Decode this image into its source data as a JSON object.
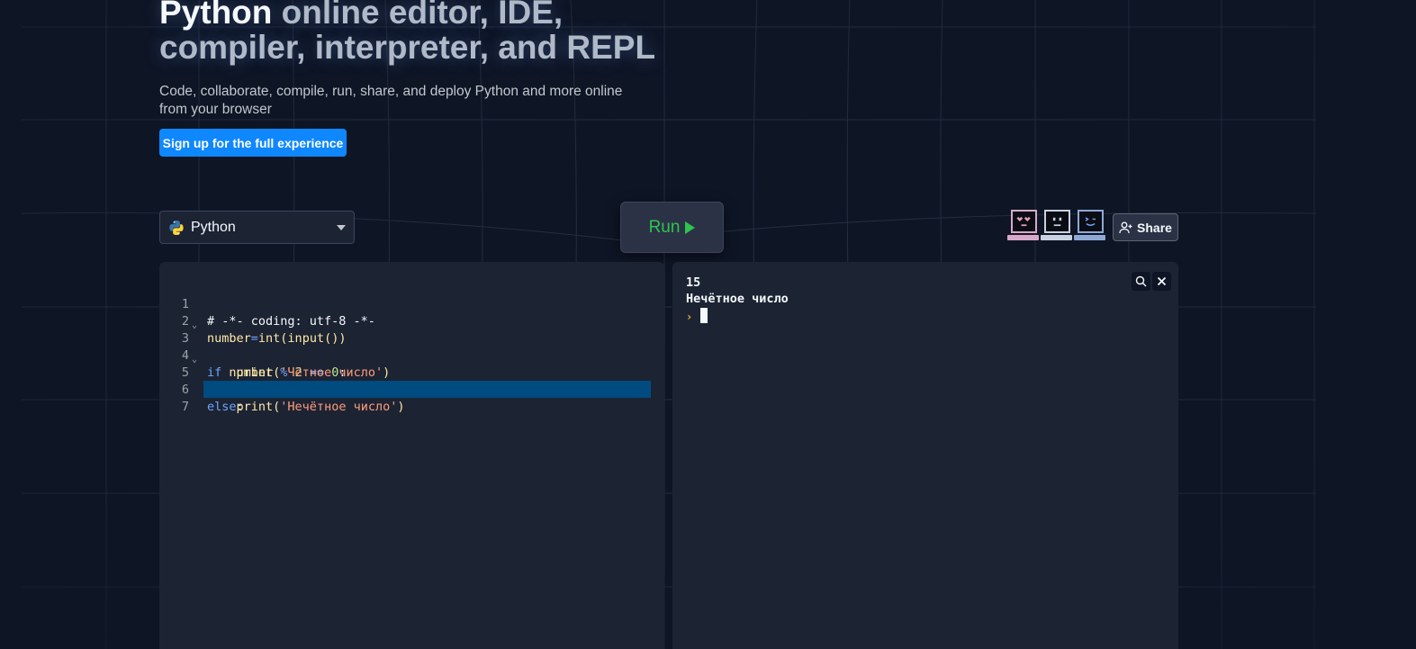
{
  "hero": {
    "title_strong": "Python",
    "title_rest": " online editor, IDE, compiler, interpreter, and REPL",
    "subtitle": "Code, collaborate, compile, run, share, and deploy Python and more online from your browser",
    "signup_label": "Sign up for the full experience"
  },
  "toolbar": {
    "language": "Python",
    "run_label": "Run",
    "share_label": "Share"
  },
  "editor": {
    "lines": [
      {
        "n": "1",
        "fold": ""
      },
      {
        "n": "2",
        "fold": ""
      },
      {
        "n": "3",
        "fold": "⌄"
      },
      {
        "n": "4",
        "fold": ""
      },
      {
        "n": "5",
        "fold": "⌄"
      },
      {
        "n": "6",
        "fold": ""
      },
      {
        "n": "7",
        "fold": ""
      }
    ],
    "code": {
      "l1": "# -*- coding: utf-8 -*-",
      "l2_var": "number",
      "l2_eq": "=",
      "l2_fn": "int(input())",
      "l3_kw": "if",
      "l3_var": " number ",
      "l3_op1": "%",
      "l3_num1": " 2 ",
      "l3_op2": "==",
      "l3_num2": " 0",
      "l3_colon": ":",
      "l4_indent": "    ",
      "l4_fn": "print(",
      "l4_str": "'Чётное число'",
      "l4_close": ")",
      "l5_kw": "else",
      "l5_colon": ":",
      "l6_indent": "    ",
      "l6_fn": "print(",
      "l6_str": "'Нечётное число'",
      "l6_close": ")"
    }
  },
  "console": {
    "output": [
      "15",
      "Нечётное число"
    ],
    "prompt": "›"
  },
  "colors": {
    "accent_blue": "#0f87ff",
    "run_green": "#2ec44f",
    "background": "#0e1525",
    "panel": "#1c2333"
  }
}
